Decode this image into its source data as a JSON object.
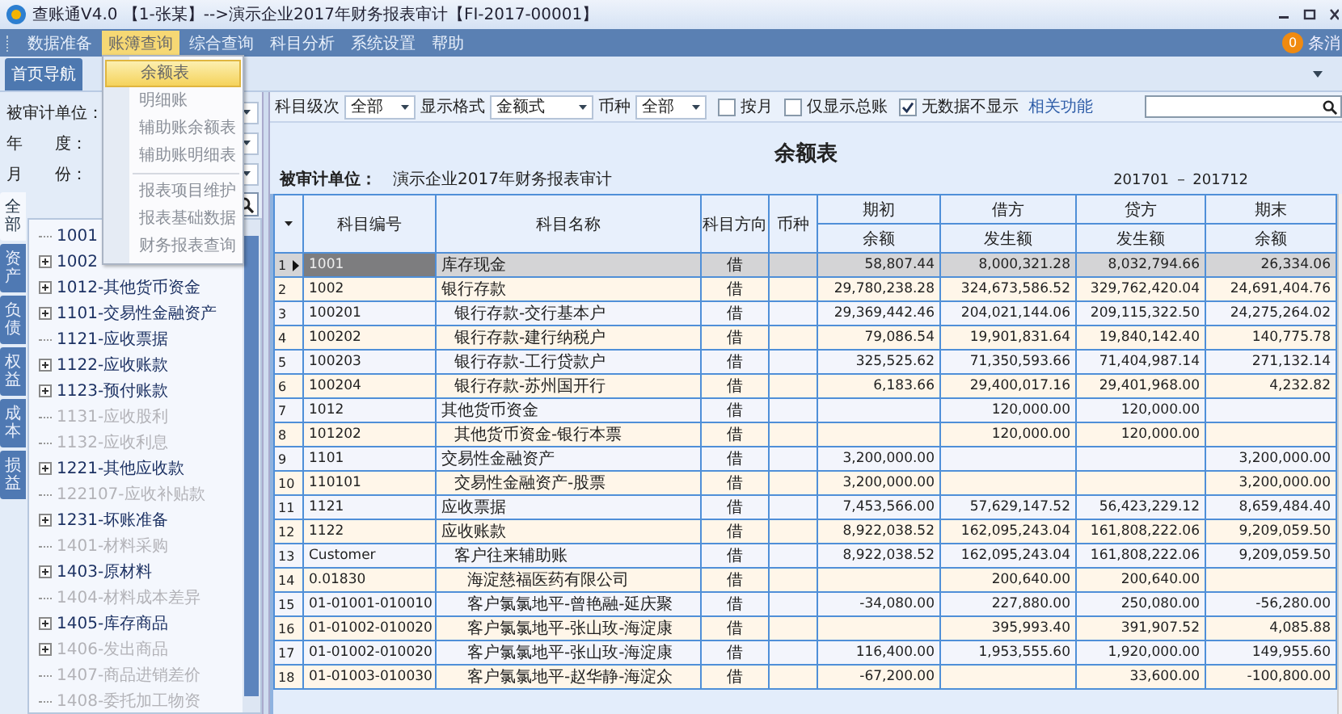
{
  "window": {
    "title": "查账通V4.0 【1-张某】-->演示企业2017年财务报表审计【FI-2017-00001】"
  },
  "menu": [
    {
      "label": "数据准备",
      "selected": false
    },
    {
      "label": "账簿查询",
      "selected": true
    },
    {
      "label": "综合查询",
      "selected": false
    },
    {
      "label": "科目分析",
      "selected": false
    },
    {
      "label": "系统设置",
      "selected": false
    },
    {
      "label": "帮助",
      "selected": false
    }
  ],
  "dropdown": [
    {
      "kind": "item",
      "label": "余额表",
      "selected": true
    },
    {
      "kind": "item",
      "label": "明细账",
      "selected": false
    },
    {
      "kind": "item",
      "label": "辅助账余额表",
      "selected": false
    },
    {
      "kind": "item",
      "label": "辅助账明细表",
      "selected": false
    },
    {
      "kind": "separator"
    },
    {
      "kind": "item",
      "label": "报表项目维护",
      "selected": false
    },
    {
      "kind": "item",
      "label": "报表基础数据",
      "selected": false
    },
    {
      "kind": "item",
      "label": "财务报表查询",
      "selected": false
    }
  ],
  "notification": {
    "count": "0",
    "text": "条消"
  },
  "tabs": [
    {
      "label": "首页导航",
      "selected": true
    }
  ],
  "filters": [
    {
      "label": "被审计单位："
    },
    {
      "label": "年　　度："
    },
    {
      "label": "月　　份："
    }
  ],
  "side_tabs": [
    {
      "label": "全部",
      "selected": true
    },
    {
      "label": "资产",
      "selected": false
    },
    {
      "label": "负债",
      "selected": false
    },
    {
      "label": "权益",
      "selected": false
    },
    {
      "label": "成本",
      "selected": false
    },
    {
      "label": "损益",
      "selected": false
    }
  ],
  "tree": [
    {
      "label": "1001",
      "expandable": false,
      "disabled": false
    },
    {
      "label": "1002",
      "expandable": true,
      "disabled": false
    },
    {
      "label": "1012-其他货币资金",
      "expandable": true,
      "disabled": false
    },
    {
      "label": "1101-交易性金融资产",
      "expandable": true,
      "disabled": false
    },
    {
      "label": "1121-应收票据",
      "expandable": false,
      "disabled": false
    },
    {
      "label": "1122-应收账款",
      "expandable": true,
      "disabled": false
    },
    {
      "label": "1123-预付账款",
      "expandable": true,
      "disabled": false
    },
    {
      "label": "1131-应收股利",
      "expandable": false,
      "disabled": true
    },
    {
      "label": "1132-应收利息",
      "expandable": false,
      "disabled": true
    },
    {
      "label": "1221-其他应收款",
      "expandable": true,
      "disabled": false
    },
    {
      "label": "122107-应收补贴款",
      "expandable": false,
      "disabled": true
    },
    {
      "label": "1231-坏账准备",
      "expandable": true,
      "disabled": false
    },
    {
      "label": "1401-材料采购",
      "expandable": false,
      "disabled": true
    },
    {
      "label": "1403-原材料",
      "expandable": true,
      "disabled": false
    },
    {
      "label": "1404-材料成本差异",
      "expandable": false,
      "disabled": true
    },
    {
      "label": "1405-库存商品",
      "expandable": true,
      "disabled": false
    },
    {
      "label": "1406-发出商品",
      "expandable": true,
      "disabled": true
    },
    {
      "label": "1407-商品进销差价",
      "expandable": false,
      "disabled": true
    },
    {
      "label": "1408-委托加工物资",
      "expandable": false,
      "disabled": true
    }
  ],
  "toolbar": {
    "selects": [
      {
        "label": "科目级次",
        "value": "全部"
      },
      {
        "label": "显示格式",
        "value": "金额式"
      },
      {
        "label": "币种",
        "value": "全部"
      }
    ],
    "checkboxes": [
      {
        "label": "按月",
        "checked": false
      },
      {
        "label": "仅显示总账",
        "checked": false
      },
      {
        "label": "无数据不显示",
        "checked": true
      }
    ],
    "link": "相关功能"
  },
  "report": {
    "title": "余额表",
    "unit_label": "被审计单位：",
    "unit": "演示企业2017年财务报表审计",
    "period": "201701 － 201712"
  },
  "table": {
    "columns": [
      {
        "label": "科目编号"
      },
      {
        "label": "科目名称"
      },
      {
        "label": "科目方向"
      },
      {
        "label": "币种"
      },
      {
        "label": "期初",
        "sub": "余额"
      },
      {
        "label": "借方",
        "sub": "发生额"
      },
      {
        "label": "贷方",
        "sub": "发生额"
      },
      {
        "label": "期末",
        "sub": "余额"
      }
    ],
    "rows": [
      {
        "no": "1",
        "selected": true,
        "code": "1001",
        "name": "库存现金",
        "direction": "借",
        "opening": "58,807.44",
        "debit": "8,000,321.28",
        "credit": "8,032,794.66",
        "closing": "26,334.06"
      },
      {
        "no": "2",
        "selected": false,
        "code": "1002",
        "name": "银行存款",
        "direction": "借",
        "opening": "29,780,238.28",
        "debit": "324,673,586.52",
        "credit": "329,762,420.04",
        "closing": "24,691,404.76",
        "children": [
          {
            "no": "3",
            "selected": false,
            "code": "100201",
            "name": "银行存款-交行基本户",
            "direction": "借",
            "opening": "29,369,442.46",
            "debit": "204,021,144.06",
            "credit": "209,115,322.50",
            "closing": "24,275,264.02"
          },
          {
            "no": "4",
            "selected": false,
            "code": "100202",
            "name": "银行存款-建行纳税户",
            "direction": "借",
            "opening": "79,086.54",
            "debit": "19,901,831.64",
            "credit": "19,840,142.40",
            "closing": "140,775.78"
          },
          {
            "no": "5",
            "selected": false,
            "code": "100203",
            "name": "银行存款-工行贷款户",
            "direction": "借",
            "opening": "325,525.62",
            "debit": "71,350,593.66",
            "credit": "71,404,987.14",
            "closing": "271,132.14"
          },
          {
            "no": "6",
            "selected": false,
            "code": "100204",
            "name": "银行存款-苏州国开行",
            "direction": "借",
            "opening": "6,183.66",
            "debit": "29,400,017.16",
            "credit": "29,401,968.00",
            "closing": "4,232.82"
          }
        ]
      },
      {
        "no": "7",
        "selected": false,
        "code": "1012",
        "name": "其他货币资金",
        "direction": "借",
        "debit": "120,000.00",
        "credit": "120,000.00",
        "children": [
          {
            "no": "8",
            "selected": false,
            "code": "101202",
            "name": "其他货币资金-银行本票",
            "direction": "借",
            "debit": "120,000.00",
            "credit": "120,000.00"
          }
        ]
      },
      {
        "no": "9",
        "selected": false,
        "code": "1101",
        "name": "交易性金融资产",
        "direction": "借",
        "opening": "3,200,000.00",
        "closing": "3,200,000.00",
        "children": [
          {
            "no": "10",
            "selected": false,
            "code": "110101",
            "name": "交易性金融资产-股票",
            "direction": "借",
            "opening": "3,200,000.00",
            "closing": "3,200,000.00"
          }
        ]
      },
      {
        "no": "11",
        "selected": false,
        "code": "1121",
        "name": "应收票据",
        "direction": "借",
        "opening": "7,453,566.00",
        "debit": "57,629,147.52",
        "credit": "56,423,229.12",
        "closing": "8,659,484.40"
      },
      {
        "no": "12",
        "selected": false,
        "code": "1122",
        "name": "应收账款",
        "direction": "借",
        "opening": "8,922,038.52",
        "debit": "162,095,243.04",
        "credit": "161,808,222.06",
        "closing": "9,209,059.50",
        "children": [
          {
            "no": "13",
            "selected": false,
            "code": "Customer",
            "name": "客户往来辅助账",
            "direction": "借",
            "opening": "8,922,038.52",
            "debit": "162,095,243.04",
            "credit": "161,808,222.06",
            "closing": "9,209,059.50",
            "children": [
              {
                "no": "14",
                "selected": false,
                "code": "0.01830",
                "name": "海淀慈福医药有限公司",
                "direction": "借",
                "debit": "200,640.00",
                "credit": "200,640.00"
              },
              {
                "no": "15",
                "selected": false,
                "code": "01-01001-010010",
                "name": "客户氯氯地平-曾艳融-延庆聚",
                "direction": "借",
                "opening": "-34,080.00",
                "debit": "227,880.00",
                "credit": "250,080.00",
                "closing": "-56,280.00"
              },
              {
                "no": "16",
                "selected": false,
                "code": "01-01002-010020",
                "name": "客户氯氯地平-张山玫-海淀康",
                "direction": "借",
                "debit": "395,993.40",
                "credit": "391,907.52",
                "closing": "4,085.88"
              },
              {
                "no": "17",
                "selected": false,
                "code": "01-01002-010020",
                "name": "客户氯氯地平-张山玫-海淀康",
                "direction": "借",
                "opening": "116,400.00",
                "debit": "1,953,555.60",
                "credit": "1,920,000.00",
                "closing": "149,955.60"
              },
              {
                "no": "18",
                "selected": false,
                "code": "01-01003-010030",
                "name": "客户氯氯地平-赵华静-海淀众",
                "direction": "借",
                "opening": "-67,200.00",
                "credit": "33,600.00",
                "closing": "-100,800.00"
              }
            ]
          }
        ]
      }
    ]
  }
}
